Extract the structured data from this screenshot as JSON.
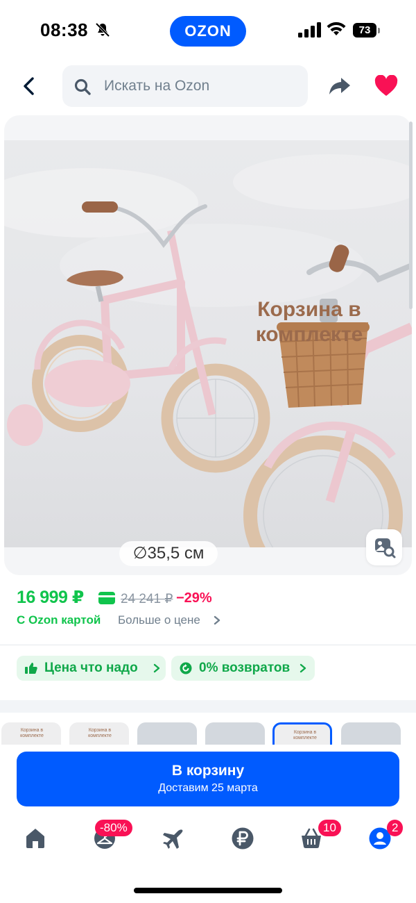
{
  "status_bar": {
    "time": "08:38",
    "brand": "OZON",
    "battery": "73"
  },
  "header": {
    "search_placeholder": "Искать на Ozon"
  },
  "gallery": {
    "photo_title": "Корзина в комплекте",
    "diameter_label": "∅35,5 см"
  },
  "price": {
    "current": "16 999 ₽",
    "old": "24 241 ₽",
    "discount": "−29%",
    "card_label": "С Ozon картой",
    "more_label": "Больше о цене"
  },
  "chips": {
    "price_ok": "Цена что надо",
    "returns": "0% возвратов"
  },
  "thumbnails": {
    "caption": "Корзина в комплекте",
    "selected_index": 4
  },
  "cart_button": {
    "title": "В корзину",
    "subtitle": "Доставим 25 марта"
  },
  "tabbar": {
    "promo_badge": "-80%",
    "cart_badge": "10",
    "profile_badge": "2"
  },
  "colors": {
    "brand_blue": "#005bff",
    "price_green": "#10c44c",
    "discount_pink": "#f91155"
  }
}
